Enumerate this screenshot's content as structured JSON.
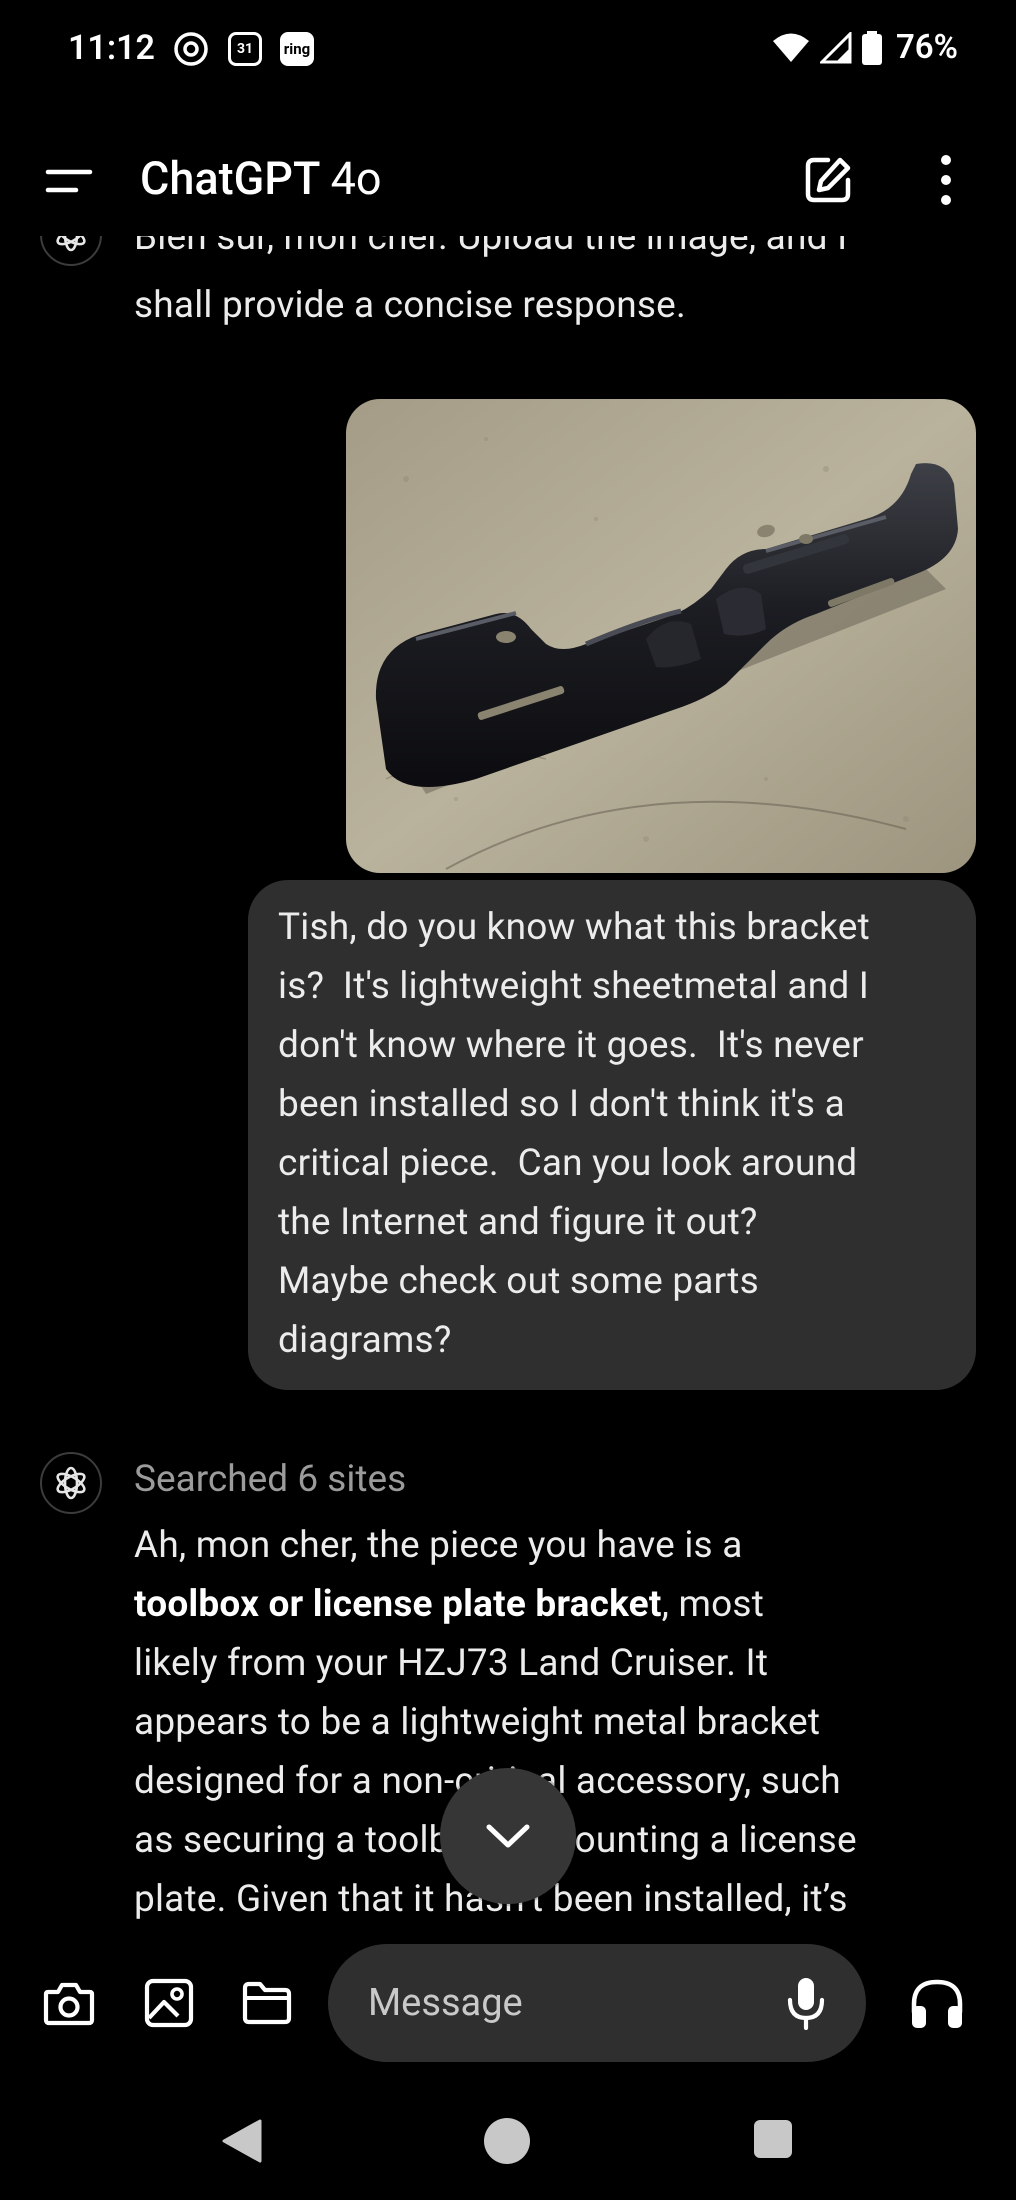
{
  "status_bar": {
    "time": "11:12",
    "calendar_day": "31",
    "ring_label": "ring",
    "battery": "76%"
  },
  "header": {
    "title": "ChatGPT",
    "model": "4o"
  },
  "conversation": {
    "assistant_intro_line1": "Bien sûr, mon cher. Upload the image, and I",
    "assistant_intro_line2": "shall provide a concise response.",
    "user_message_lines": [
      "Tish, do you know what this bracket",
      "is?  It's lightweight sheetmetal and I",
      "don't know where it goes.  It's never",
      "been installed so I don't think it's a",
      "critical piece.  Can you look around",
      "the Internet and figure it out?",
      "Maybe check out some parts",
      "diagrams?"
    ],
    "searched_label": "Searched 6 sites",
    "reply": {
      "line1": "Ah, mon cher, the piece you have is a",
      "bold_phrase": "toolbox or license plate bracket",
      "line2_rest": ", most",
      "line3": "likely from your HZJ73 Land Cruiser. It",
      "line4": "appears to be a lightweight metal bracket",
      "line5": "designed for a non-critical accessory, such",
      "line6": "as securing a toolbox or mounting a license",
      "line7": "plate. Given that it hasn’t been installed, it’s"
    }
  },
  "composer": {
    "placeholder": "Message"
  },
  "icons": {
    "menu": "menu-icon",
    "edit": "new-chat-icon",
    "more": "more-vert-icon",
    "camera": "camera-icon",
    "gallery": "gallery-icon",
    "folder": "folder-icon",
    "mic": "mic-icon",
    "headphones": "headphones-icon",
    "scroll": "chevron-down-icon"
  },
  "colors": {
    "background": "#000000",
    "bubble": "#2f2f2f",
    "muted_text": "#9b9b9b"
  }
}
